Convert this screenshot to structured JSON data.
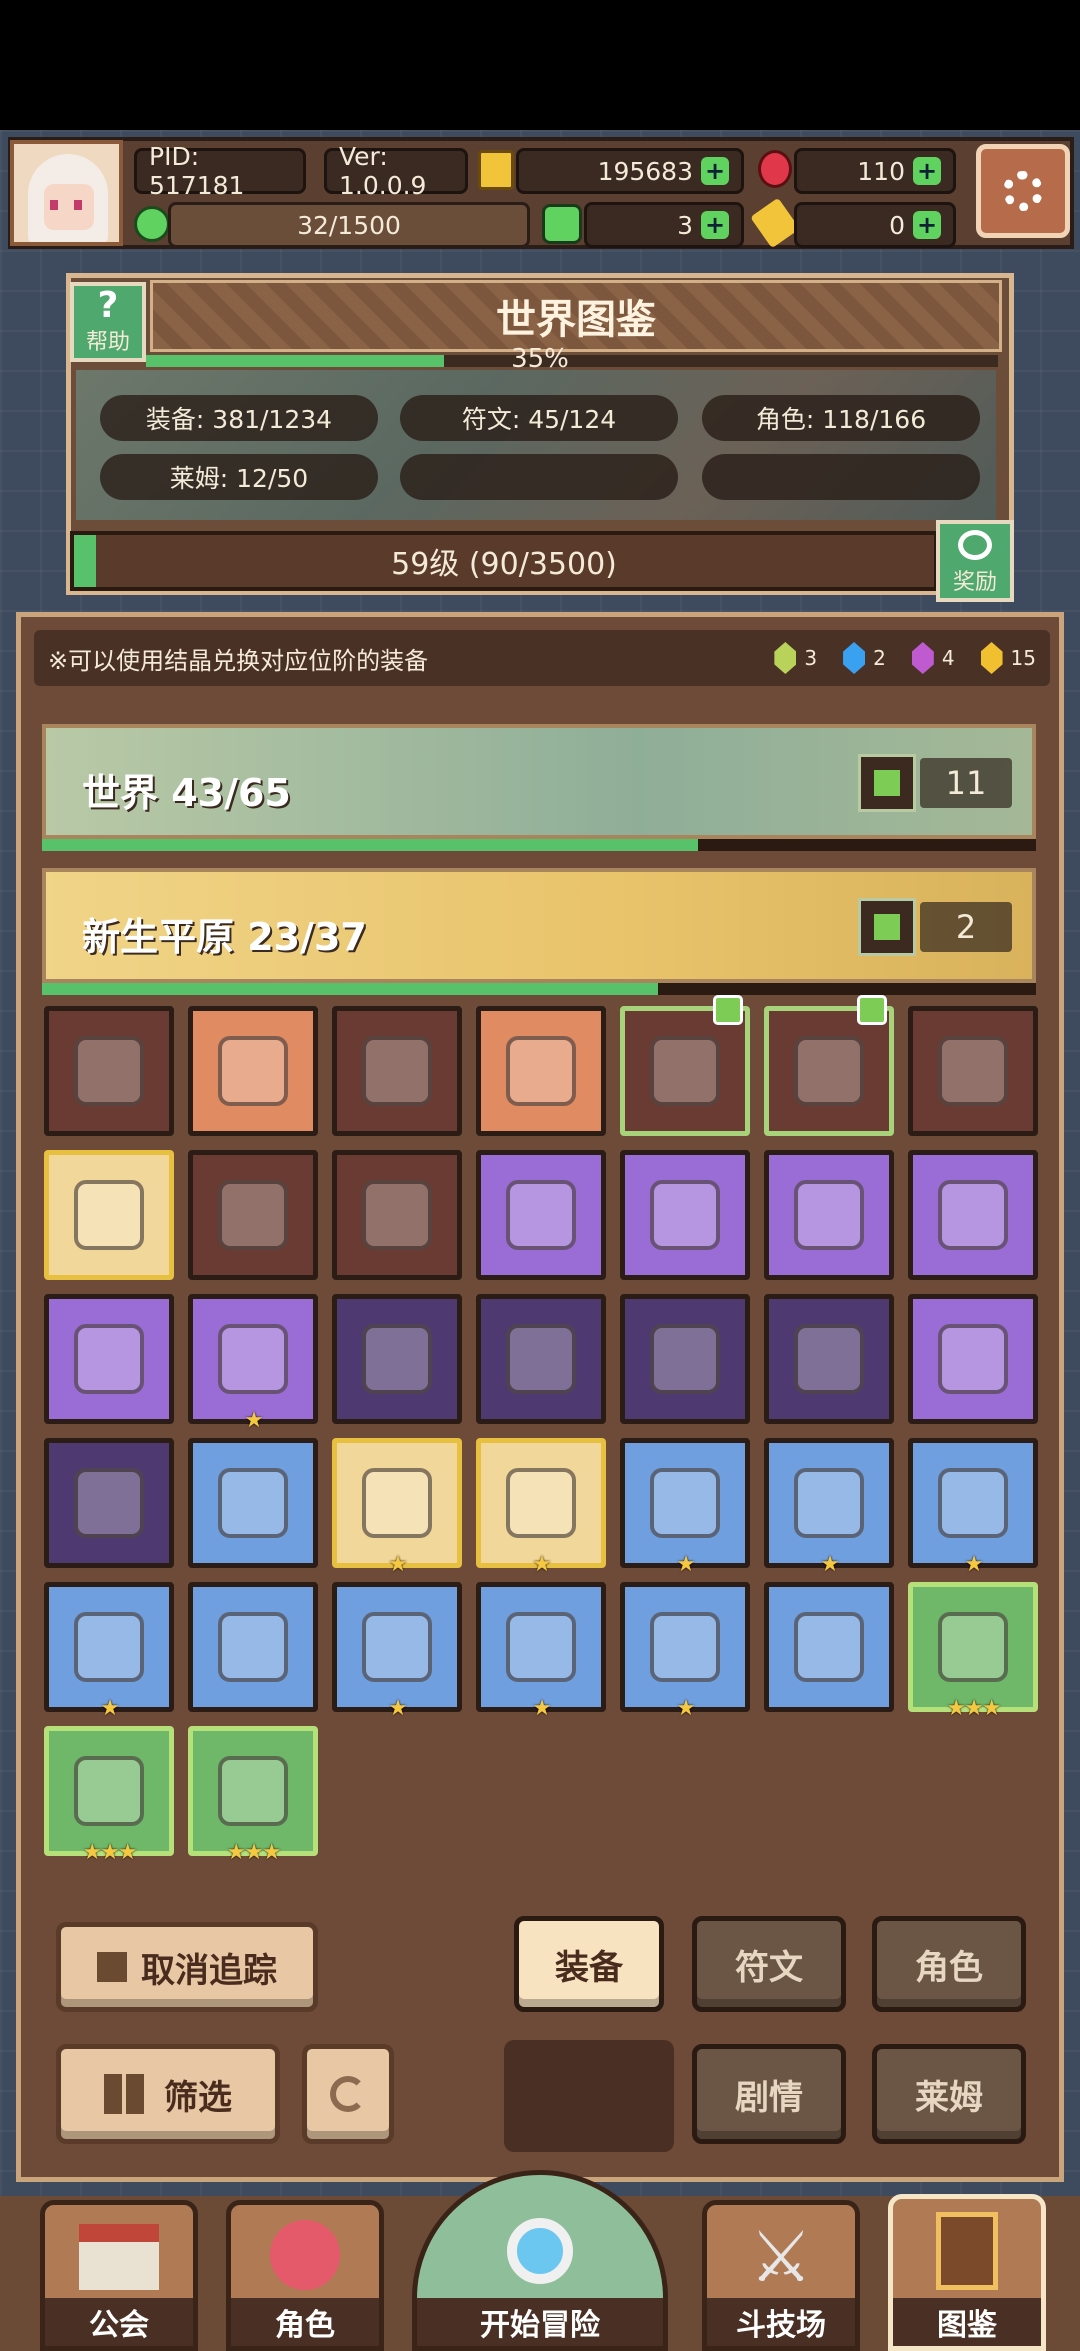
{
  "header": {
    "pid": "PID: 517181",
    "version": "Ver: 1.0.0.9",
    "gold": "195683",
    "ruby": "110",
    "stamina": "32/1500",
    "clover": "3",
    "key": "0"
  },
  "codex": {
    "title": "世界图鉴",
    "help_label": "帮助",
    "progress_text": "35%",
    "progress_value": 0.35,
    "stats": [
      "装备: 381/1234",
      "符文: 45/124",
      "角色: 118/166",
      "莱姆: 12/50"
    ],
    "level_text": "59级 (90/3500)",
    "level_progress": 0.026,
    "reward_label": "奖励"
  },
  "tip": {
    "text": "※可以使用结晶兑换对应位阶的装备",
    "gems": [
      {
        "color": "#b8d25a",
        "count": "3"
      },
      {
        "color": "#3aa0f0",
        "count": "2"
      },
      {
        "color": "#c05ad0",
        "count": "4"
      },
      {
        "color": "#f0c030",
        "count": "15"
      }
    ]
  },
  "categories": [
    {
      "name": "世界 43/65",
      "tracked": "11",
      "progress": 0.66,
      "bg": "#8fae98"
    },
    {
      "name": "新生平原 23/37",
      "tracked": "2",
      "progress": 0.62,
      "bg": "#e8c36a"
    }
  ],
  "items": [
    {
      "icon": "hat-icon",
      "rar": "dark",
      "stars": ""
    },
    {
      "icon": "staff-icon",
      "rar": "orange",
      "stars": ""
    },
    {
      "icon": "orb-icon",
      "rar": "dark",
      "stars": ""
    },
    {
      "icon": "crystal-icon",
      "rar": "orange",
      "stars": ""
    },
    {
      "icon": "axe-icon",
      "rar": "dark",
      "stars": "",
      "tracked": true
    },
    {
      "icon": "necklace-icon",
      "rar": "dark",
      "stars": "",
      "tracked": true
    },
    {
      "icon": "ring-icon",
      "rar": "dark",
      "stars": ""
    },
    {
      "icon": "pearl-icon",
      "rar": "gold",
      "stars": ""
    },
    {
      "icon": "glove-icon",
      "rar": "dark",
      "stars": ""
    },
    {
      "icon": "necklace-icon",
      "rar": "dark",
      "stars": ""
    },
    {
      "icon": "wand-icon",
      "rar": "purple",
      "stars": ""
    },
    {
      "icon": "wizard-hat-icon",
      "rar": "purple",
      "stars": ""
    },
    {
      "icon": "armor-icon",
      "rar": "purple",
      "stars": ""
    },
    {
      "icon": "bracer-icon",
      "rar": "purple",
      "stars": ""
    },
    {
      "icon": "belt-icon",
      "rar": "purple",
      "stars": ""
    },
    {
      "icon": "boots-icon",
      "rar": "purple",
      "stars": "★"
    },
    {
      "icon": "amulet-icon",
      "rar": "dpurple",
      "stars": ""
    },
    {
      "icon": "necklace-icon",
      "rar": "dpurple",
      "stars": ""
    },
    {
      "icon": "ring-icon",
      "rar": "dpurple",
      "stars": ""
    },
    {
      "icon": "glove-icon",
      "rar": "dpurple",
      "stars": ""
    },
    {
      "icon": "ring-icon",
      "rar": "purple",
      "stars": ""
    },
    {
      "icon": "boots-icon",
      "rar": "dpurple",
      "stars": ""
    },
    {
      "icon": "scepter-icon",
      "rar": "blue",
      "stars": ""
    },
    {
      "icon": "fire-orb-icon",
      "rar": "gold",
      "stars": "★"
    },
    {
      "icon": "ring-icon",
      "rar": "gold",
      "stars": "★"
    },
    {
      "icon": "hood-icon",
      "rar": "blue",
      "stars": "★"
    },
    {
      "icon": "armor-icon",
      "rar": "blue",
      "stars": "★"
    },
    {
      "icon": "boots-icon",
      "rar": "blue",
      "stars": "★"
    },
    {
      "icon": "staff-icon",
      "rar": "blue",
      "stars": "★"
    },
    {
      "icon": "necklace-icon",
      "rar": "blue",
      "stars": ""
    },
    {
      "icon": "ring-icon",
      "rar": "blue",
      "stars": "★"
    },
    {
      "icon": "armor-icon",
      "rar": "blue",
      "stars": "★"
    },
    {
      "icon": "necklace-icon",
      "rar": "blue",
      "stars": "★"
    },
    {
      "icon": "boots-icon",
      "rar": "blue",
      "stars": ""
    },
    {
      "icon": "bracelet-icon",
      "rar": "green",
      "stars": "★★★"
    },
    {
      "icon": "boots-icon",
      "rar": "green",
      "stars": "★★★"
    },
    {
      "icon": "necklace-icon",
      "rar": "green",
      "stars": "★★★"
    }
  ],
  "controls": {
    "untrack": "取消追踪",
    "filter": "筛选",
    "tabs": [
      "装备",
      "符文",
      "角色",
      "剧情",
      "莱姆"
    ]
  },
  "nav": [
    "公会",
    "角色",
    "开始冒险",
    "斗技场",
    "图鉴"
  ],
  "colors": {
    "accent": "#58c26a",
    "panel": "#6e4b38"
  }
}
